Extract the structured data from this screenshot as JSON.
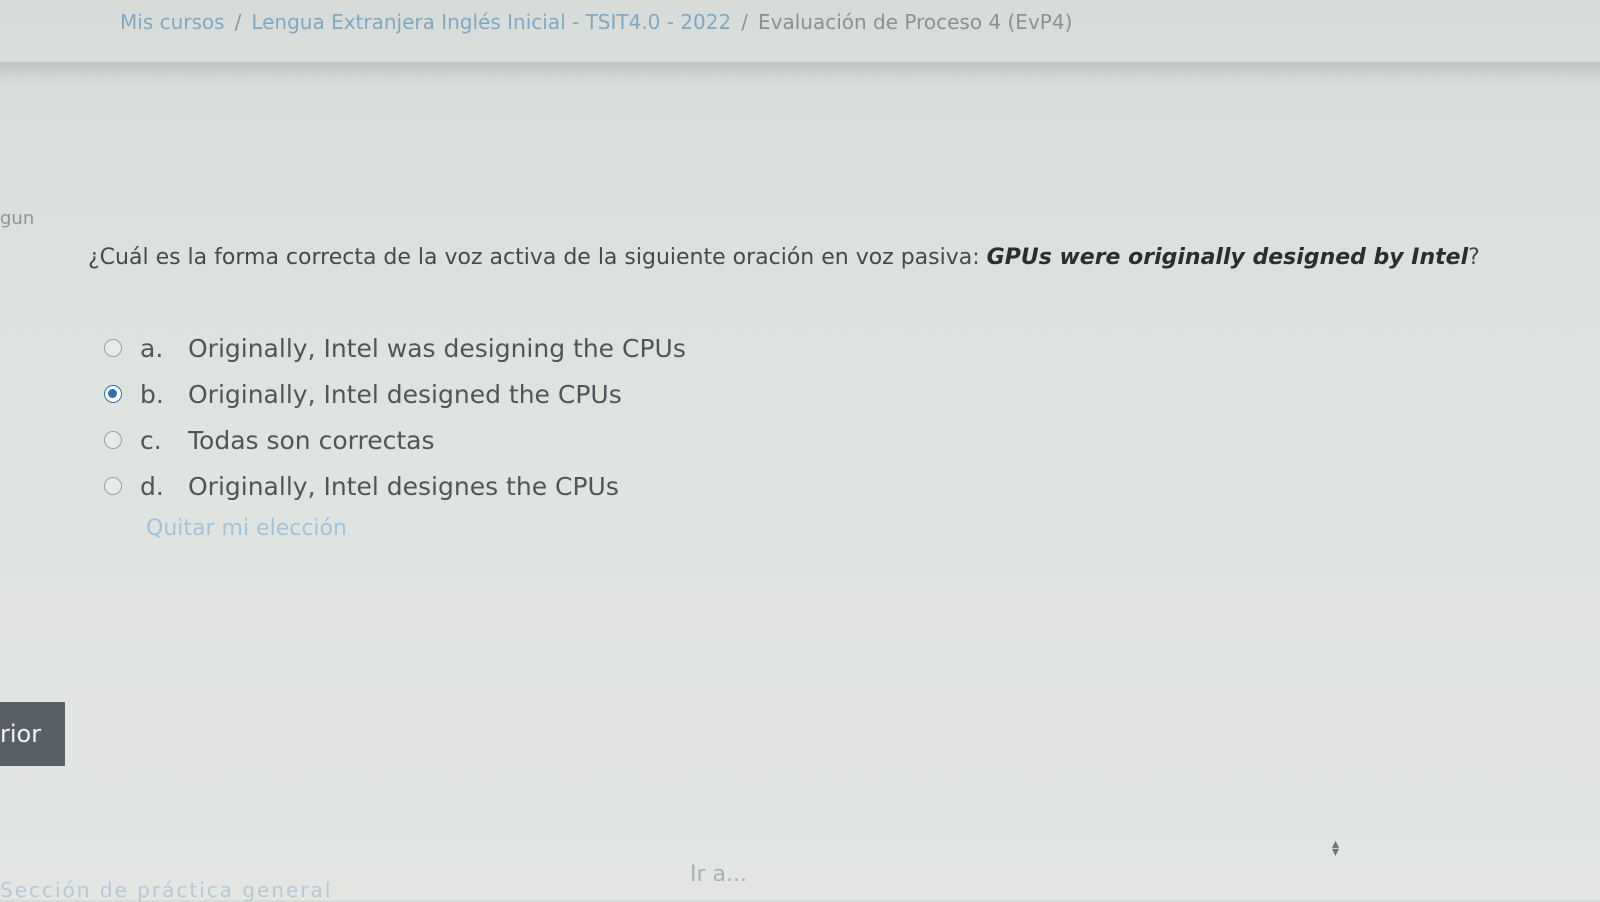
{
  "breadcrumb": {
    "items": [
      "Mis cursos",
      "Lengua Extranjera Inglés Inicial - TSIT4.0 - 2022",
      "Evaluación de Proceso 4 (EvP4)"
    ],
    "separator": "/"
  },
  "sidebar": {
    "partial_label": "gun"
  },
  "question": {
    "text": "¿Cuál es la forma correcta de la voz activa de la siguiente oración en voz pasiva: ",
    "emphasis": "GPUs were originally designed by Intel",
    "suffix": "?"
  },
  "answers": [
    {
      "letter": "a.",
      "text": "Originally, Intel was designing the CPUs",
      "selected": false
    },
    {
      "letter": "b.",
      "text": "Originally, Intel designed the CPUs",
      "selected": true
    },
    {
      "letter": "c.",
      "text": "Todas son correctas",
      "selected": false
    },
    {
      "letter": "d.",
      "text": "Originally, Intel designes the CPUs",
      "selected": false
    }
  ],
  "clear_choice_label": "Quitar mi elección",
  "prev_button_label": "rior",
  "footer": {
    "link_label": "Sección de práctica general",
    "jump_label": "Ir a..."
  },
  "colors": {
    "accent": "#2f6fb3",
    "link": "#9fc3dc",
    "button": "#5a6166"
  }
}
